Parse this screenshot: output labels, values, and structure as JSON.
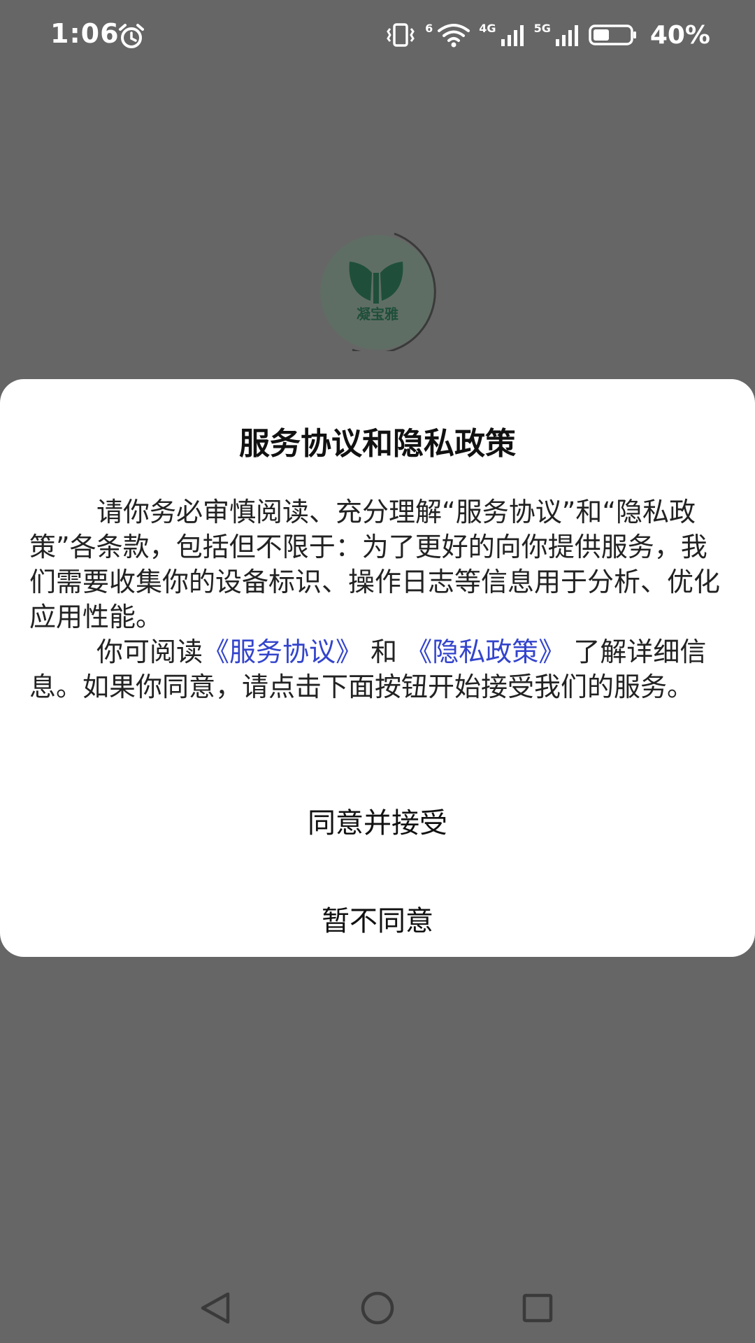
{
  "status_bar": {
    "time": "1:06",
    "battery_percent": "40%",
    "net_label_1": "4G",
    "net_label_2": "5G",
    "wifi_label": "6",
    "icons": [
      "alarm-icon",
      "vibrate-icon",
      "wifi-icon",
      "signal-4g-icon",
      "signal-5g-icon",
      "battery-icon"
    ]
  },
  "splash": {
    "logo_text": "凝宝雅",
    "brand_color": "#1f6e4a"
  },
  "dialog": {
    "title": "服务协议和隐私政策",
    "paragraph1": "请你务必审慎阅读、充分理解“服务协议”和“隐私政策”各条款，包括但不限于：为了更好的向你提供服务，我们需要收集你的设备标识、操作日志等信息用于分析、优化应用性能。",
    "p2_prefix": "你可阅读",
    "link_service": "《服务协议》",
    "p2_and": "和",
    "link_privacy": "《隐私政策》",
    "p2_suffix": "了解详细信息。如果你同意，请点击下面按钮开始接受我们的服务。",
    "agree_button": "同意并接受",
    "disagree_button": "暂不同意",
    "link_color": "#3344cc"
  },
  "nav_bar": {
    "icons": [
      "back-icon",
      "home-icon",
      "recents-icon"
    ]
  }
}
